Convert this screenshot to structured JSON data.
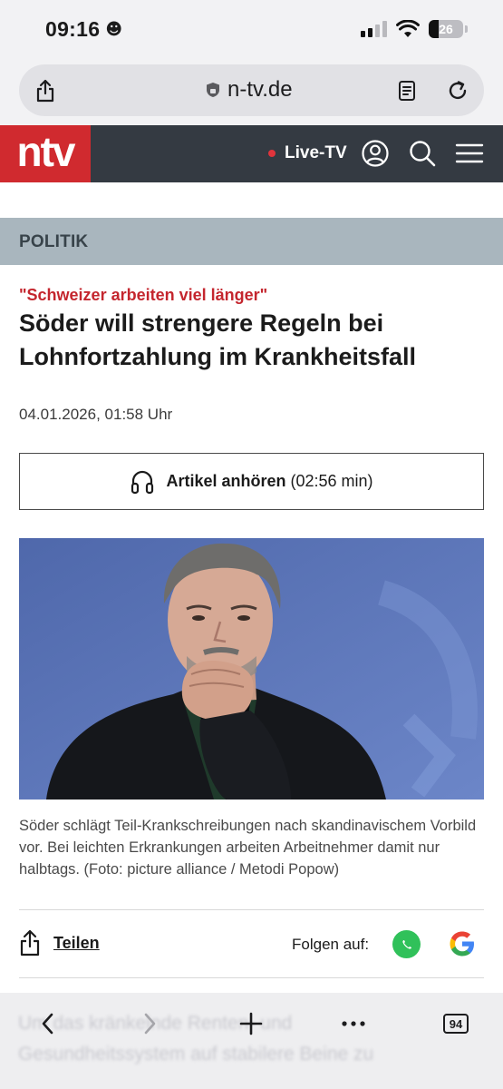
{
  "status_bar": {
    "time": "09:16",
    "time_emoji": "☻",
    "battery": "26"
  },
  "browser": {
    "url": "n-tv.de"
  },
  "site_header": {
    "logo": "ntv",
    "live_tv": "Live-TV"
  },
  "article": {
    "category": "POLITIK",
    "kicker": "\"Schweizer arbeiten viel länger\"",
    "headline": "Söder will strengere Regeln bei Lohnfortzahlung im Krankheitsfall",
    "date": "04.01.2026, 01:58 Uhr",
    "listen_label": "Artikel anhören",
    "listen_duration": "(02:56 min)",
    "caption": "Söder schlägt Teil-Krankschreibungen nach skandinavischem Vorbild vor. Bei leichten Erkrankungen arbeiten Arbeitnehmer damit nur halbtags. (Foto: picture alliance / Metodi Popow)",
    "share_label": "Teilen",
    "follow_label": "Folgen auf:"
  },
  "toolbar": {
    "tab_count": "94",
    "behind_text_1": "Um das kränkelnde Renten- und",
    "behind_text_2": "Gesundheitssystem auf stabilere Beine zu"
  },
  "colors": {
    "brand_red": "#d02a2f",
    "header_dark": "#343a42",
    "category_bg": "#a9b6be",
    "kicker_red": "#c4262e"
  }
}
